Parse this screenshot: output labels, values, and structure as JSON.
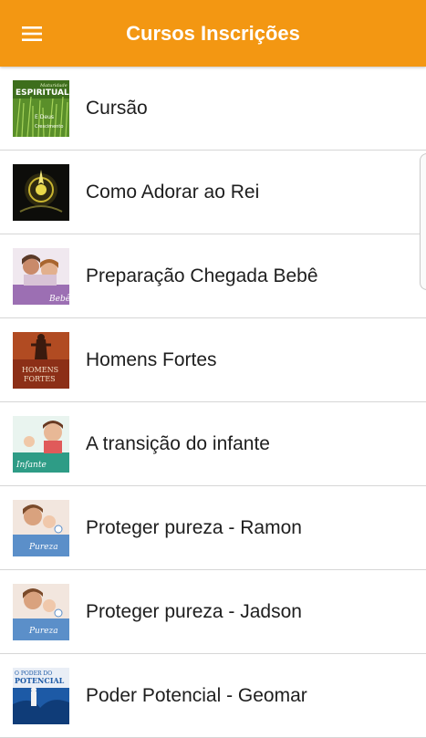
{
  "app_bar": {
    "title": "Cursos Inscrições",
    "menu_icon": "menu-icon",
    "background": "#f39712"
  },
  "courses": [
    {
      "label": "Cursão",
      "thumb_icon": "course-thumbnail-maturidade-espiritual",
      "thumb_text": [
        "Maturidade",
        "ESPIRITUAL",
        "E Deus",
        "Crescimento"
      ]
    },
    {
      "label": "Como Adorar ao Rei",
      "thumb_icon": "course-thumbnail-adorar"
    },
    {
      "label": "Preparação Chegada Bebê",
      "thumb_icon": "course-thumbnail-bebe",
      "thumb_text": [
        "Bebê"
      ]
    },
    {
      "label": "Homens Fortes",
      "thumb_icon": "course-thumbnail-homens-fortes",
      "thumb_text": [
        "HOMENS",
        "FORTES"
      ]
    },
    {
      "label": "A transição do infante",
      "thumb_icon": "course-thumbnail-infante",
      "thumb_text": [
        "Infante"
      ]
    },
    {
      "label": "Proteger pureza - Ramon",
      "thumb_icon": "course-thumbnail-pureza",
      "thumb_text": [
        "Pureza"
      ]
    },
    {
      "label": "Proteger pureza - Jadson",
      "thumb_icon": "course-thumbnail-pureza",
      "thumb_text": [
        "Pureza"
      ]
    },
    {
      "label": "Poder Potencial - Geomar",
      "thumb_icon": "course-thumbnail-poder-potencial",
      "thumb_text": [
        "O PODER DO",
        "POTENCIAL"
      ]
    }
  ]
}
